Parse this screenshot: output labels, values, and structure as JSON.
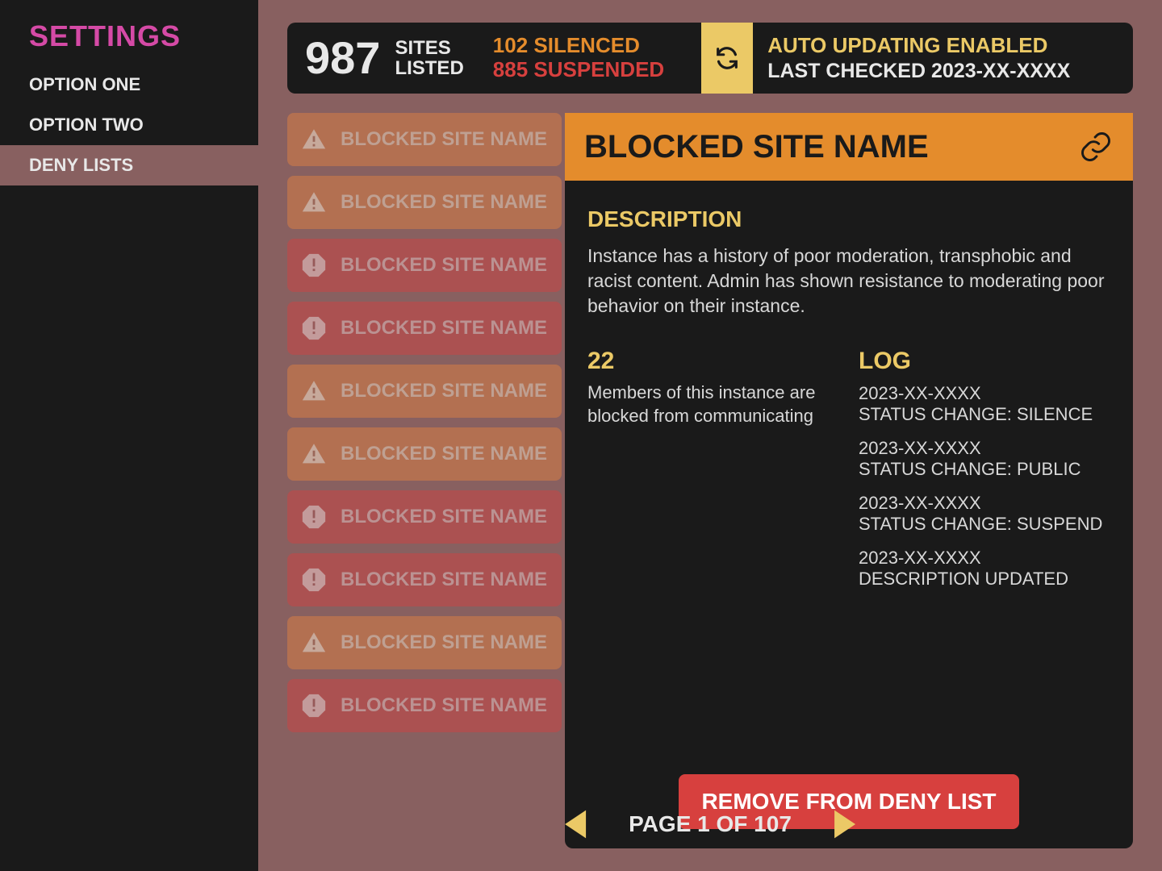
{
  "sidebar": {
    "title": "SETTINGS",
    "items": [
      {
        "label": "OPTION ONE",
        "active": false
      },
      {
        "label": "OPTION TWO",
        "active": false
      },
      {
        "label": "DENY LISTS",
        "active": true
      }
    ]
  },
  "header": {
    "count": "987",
    "sites_label_1": "SITES",
    "sites_label_2": "LISTED",
    "silenced": "102 SILENCED",
    "suspended": "885 SUSPENDED",
    "auto_update_top": "AUTO UPDATING ENABLED",
    "auto_update_bottom": "LAST CHECKED 2023-XX-XXXX"
  },
  "list": [
    {
      "name": "BLOCKED SITE NAME",
      "type": "triangle"
    },
    {
      "name": "BLOCKED SITE NAME",
      "type": "triangle"
    },
    {
      "name": "BLOCKED SITE NAME",
      "type": "octagon"
    },
    {
      "name": "BLOCKED SITE NAME",
      "type": "octagon"
    },
    {
      "name": "BLOCKED SITE NAME",
      "type": "triangle"
    },
    {
      "name": "BLOCKED SITE NAME",
      "type": "triangle"
    },
    {
      "name": "BLOCKED SITE NAME",
      "type": "octagon"
    },
    {
      "name": "BLOCKED SITE NAME",
      "type": "octagon"
    },
    {
      "name": "BLOCKED SITE NAME",
      "type": "triangle"
    },
    {
      "name": "BLOCKED SITE NAME",
      "type": "octagon"
    }
  ],
  "detail": {
    "title": "BLOCKED SITE NAME",
    "desc_heading": "DESCRIPTION",
    "desc_text": "Instance has a history of poor moderation, transphobic and racist content. Admin has shown resistance to moderating poor behavior on their instance.",
    "members_count": "22",
    "members_text": "Members of this instance are blocked from communicating",
    "log_heading": "LOG",
    "log": [
      {
        "date": "2023-XX-XXXX",
        "action": "STATUS CHANGE: SILENCE"
      },
      {
        "date": "2023-XX-XXXX",
        "action": "STATUS CHANGE:  PUBLIC"
      },
      {
        "date": "2023-XX-XXXX",
        "action": "STATUS CHANGE:  SUSPEND"
      },
      {
        "date": "2023-XX-XXXX",
        "action": "DESCRIPTION UPDATED"
      }
    ],
    "remove_label": "REMOVE FROM DENY LIST"
  },
  "pagination": {
    "label": "PAGE 1 OF 107"
  }
}
